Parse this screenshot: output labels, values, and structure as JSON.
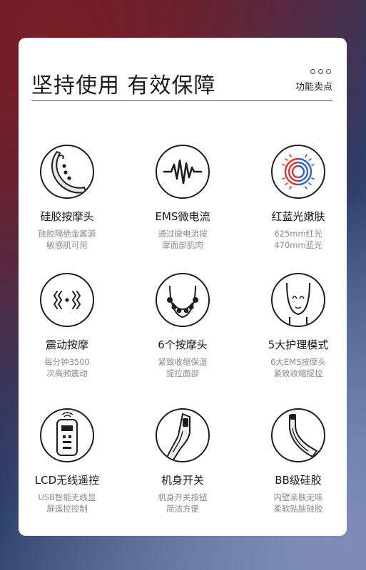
{
  "page": {
    "title": "坚持使用  有效保障",
    "tag": "功能卖点"
  },
  "features": [
    {
      "label": "硅胶按摩头",
      "desc": [
        "硅胶隔绝金属源",
        "敏感肌可用"
      ],
      "icon": "silicone-head-icon"
    },
    {
      "label": "EMS微电流",
      "desc": [
        "通过微电流按",
        "摩面部肌肉"
      ],
      "icon": "ems-wave-icon"
    },
    {
      "label": "红蓝光嫩肤",
      "desc": [
        "625mm红光",
        "470mm蓝光"
      ],
      "icon": "red-blue-light-icon"
    },
    {
      "label": "震动按摩",
      "desc": [
        "每分钟3500",
        "次高频震动"
      ],
      "icon": "vibration-icon"
    },
    {
      "label": "6个按摩头",
      "desc": [
        "紧致收缩保湿",
        "提拉面部"
      ],
      "icon": "six-heads-face-icon"
    },
    {
      "label": "5大护理模式",
      "desc": [
        "6大EMS按摩头",
        "紧致收缩提拉"
      ],
      "icon": "face-outline-icon"
    },
    {
      "label": "LCD无线遥控",
      "desc": [
        "USB智能无线显",
        "屏遥控控制"
      ],
      "icon": "remote-control-icon"
    },
    {
      "label": "机身开关",
      "desc": [
        "机身开关按钮",
        "简洁方便"
      ],
      "icon": "power-button-icon"
    },
    {
      "label": "BB级硅胶",
      "desc": [
        "内壁亲肤无味",
        "柔软贴肤硅胶"
      ],
      "icon": "bb-silicone-icon"
    }
  ],
  "colors": {
    "red_light": "#e0322e",
    "blue_light": "#2f64c8",
    "text": "#1a1a1a",
    "muted": "#8a8a8a"
  }
}
